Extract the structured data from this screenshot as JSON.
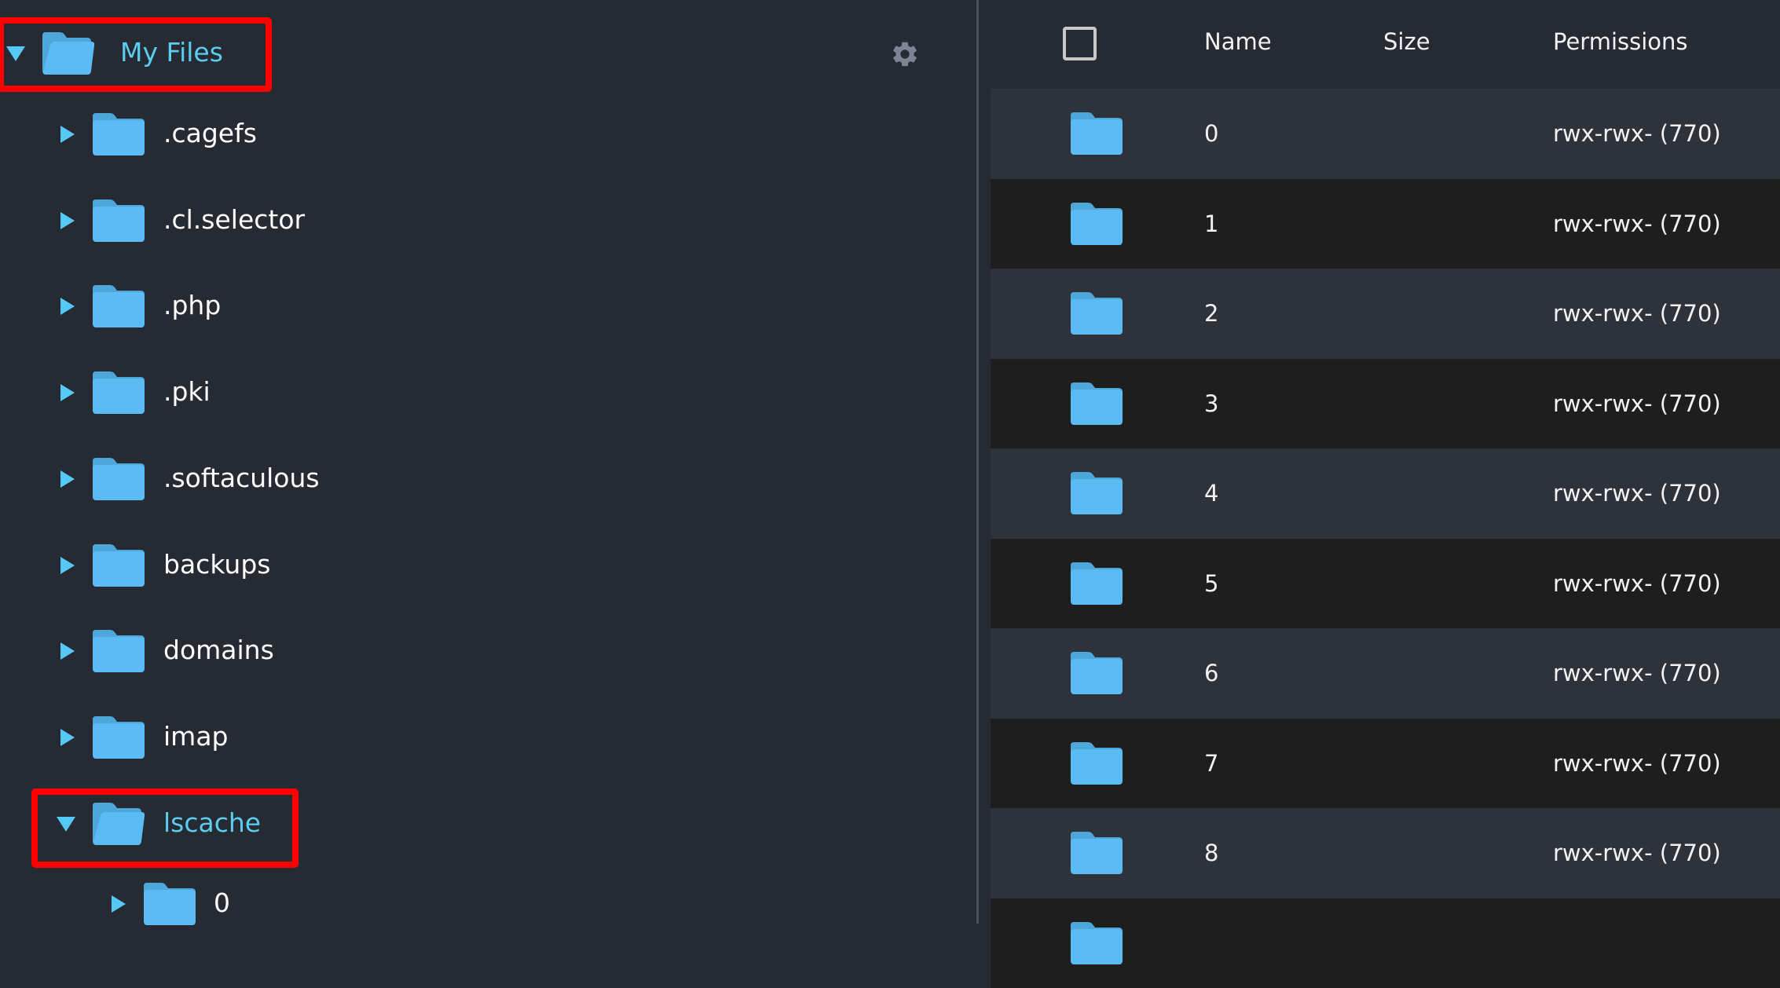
{
  "tree": {
    "root": {
      "label": "My Files",
      "expanded": true,
      "highlighted": true
    },
    "items": [
      {
        "label": ".cagefs",
        "expanded": false
      },
      {
        "label": ".cl.selector",
        "expanded": false
      },
      {
        "label": ".php",
        "expanded": false
      },
      {
        "label": ".pki",
        "expanded": false
      },
      {
        "label": ".softaculous",
        "expanded": false
      },
      {
        "label": "backups",
        "expanded": false
      },
      {
        "label": "domains",
        "expanded": false
      },
      {
        "label": "imap",
        "expanded": false
      },
      {
        "label": "lscache",
        "expanded": true,
        "highlighted": true
      }
    ],
    "sub_items": [
      {
        "label": "0",
        "expanded": false
      }
    ],
    "settings_icon": "gear-icon"
  },
  "table": {
    "columns": {
      "name": "Name",
      "size": "Size",
      "permissions": "Permissions"
    },
    "rows": [
      {
        "name": "0",
        "size": "",
        "permissions": "rwx-rwx- (770)"
      },
      {
        "name": "1",
        "size": "",
        "permissions": "rwx-rwx- (770)"
      },
      {
        "name": "2",
        "size": "",
        "permissions": "rwx-rwx- (770)"
      },
      {
        "name": "3",
        "size": "",
        "permissions": "rwx-rwx- (770)"
      },
      {
        "name": "4",
        "size": "",
        "permissions": "rwx-rwx- (770)"
      },
      {
        "name": "5",
        "size": "",
        "permissions": "rwx-rwx- (770)"
      },
      {
        "name": "6",
        "size": "",
        "permissions": "rwx-rwx- (770)"
      },
      {
        "name": "7",
        "size": "",
        "permissions": "rwx-rwx- (770)"
      },
      {
        "name": "8",
        "size": "",
        "permissions": "rwx-rwx- (770)"
      },
      {
        "name": "",
        "size": "",
        "permissions": ""
      }
    ]
  },
  "colors": {
    "accent": "#5bcdf0",
    "folder": "#5bbcf5",
    "highlight": "#ff0000",
    "background": "#262a33"
  }
}
